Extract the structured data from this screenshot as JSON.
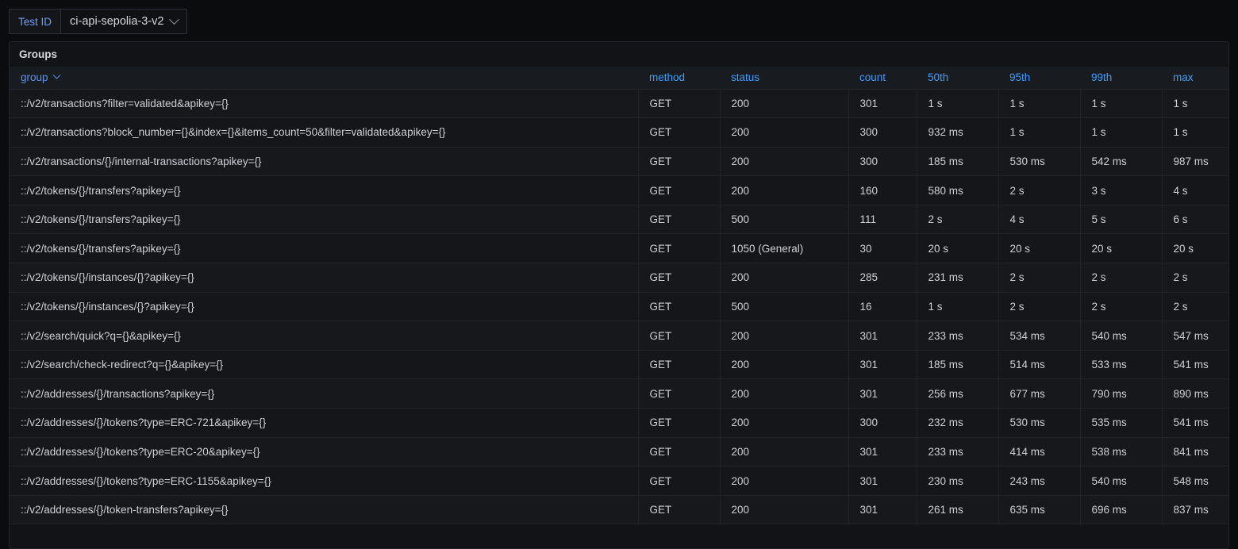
{
  "variables": {
    "test_id": {
      "label": "Test ID",
      "value": "ci-api-sepolia-3-v2",
      "chevron_icon": "chevron-down-icon"
    }
  },
  "panel": {
    "title": "Groups",
    "table": {
      "columns": [
        {
          "key": "group",
          "label": "group",
          "sorted": true,
          "sort_icon": "chevron-down-icon"
        },
        {
          "key": "method",
          "label": "method",
          "sorted": false
        },
        {
          "key": "status",
          "label": "status",
          "sorted": false
        },
        {
          "key": "count",
          "label": "count",
          "sorted": false
        },
        {
          "key": "p50",
          "label": "50th",
          "sorted": false
        },
        {
          "key": "p95",
          "label": "95th",
          "sorted": false
        },
        {
          "key": "p99",
          "label": "99th",
          "sorted": false
        },
        {
          "key": "max",
          "label": "max",
          "sorted": false
        }
      ],
      "rows": [
        {
          "group": "::/v2/transactions?filter=validated&apikey={}",
          "method": "GET",
          "status": "200",
          "count": "301",
          "p50": "1 s",
          "p95": "1 s",
          "p99": "1 s",
          "max": "1 s"
        },
        {
          "group": "::/v2/transactions?block_number={}&index={}&items_count=50&filter=validated&apikey={}",
          "method": "GET",
          "status": "200",
          "count": "300",
          "p50": "932 ms",
          "p95": "1 s",
          "p99": "1 s",
          "max": "1 s"
        },
        {
          "group": "::/v2/transactions/{}/internal-transactions?apikey={}",
          "method": "GET",
          "status": "200",
          "count": "300",
          "p50": "185 ms",
          "p95": "530 ms",
          "p99": "542 ms",
          "max": "987 ms"
        },
        {
          "group": "::/v2/tokens/{}/transfers?apikey={}",
          "method": "GET",
          "status": "200",
          "count": "160",
          "p50": "580 ms",
          "p95": "2 s",
          "p99": "3 s",
          "max": "4 s"
        },
        {
          "group": "::/v2/tokens/{}/transfers?apikey={}",
          "method": "GET",
          "status": "500",
          "count": "111",
          "p50": "2 s",
          "p95": "4 s",
          "p99": "5 s",
          "max": "6 s"
        },
        {
          "group": "::/v2/tokens/{}/transfers?apikey={}",
          "method": "GET",
          "status": "1050 (General)",
          "count": "30",
          "p50": "20 s",
          "p95": "20 s",
          "p99": "20 s",
          "max": "20 s"
        },
        {
          "group": "::/v2/tokens/{}/instances/{}?apikey={}",
          "method": "GET",
          "status": "200",
          "count": "285",
          "p50": "231 ms",
          "p95": "2 s",
          "p99": "2 s",
          "max": "2 s"
        },
        {
          "group": "::/v2/tokens/{}/instances/{}?apikey={}",
          "method": "GET",
          "status": "500",
          "count": "16",
          "p50": "1 s",
          "p95": "2 s",
          "p99": "2 s",
          "max": "2 s"
        },
        {
          "group": "::/v2/search/quick?q={}&apikey={}",
          "method": "GET",
          "status": "200",
          "count": "301",
          "p50": "233 ms",
          "p95": "534 ms",
          "p99": "540 ms",
          "max": "547 ms"
        },
        {
          "group": "::/v2/search/check-redirect?q={}&apikey={}",
          "method": "GET",
          "status": "200",
          "count": "301",
          "p50": "185 ms",
          "p95": "514 ms",
          "p99": "533 ms",
          "max": "541 ms"
        },
        {
          "group": "::/v2/addresses/{}/transactions?apikey={}",
          "method": "GET",
          "status": "200",
          "count": "301",
          "p50": "256 ms",
          "p95": "677 ms",
          "p99": "790 ms",
          "max": "890 ms"
        },
        {
          "group": "::/v2/addresses/{}/tokens?type=ERC-721&apikey={}",
          "method": "GET",
          "status": "200",
          "count": "300",
          "p50": "232 ms",
          "p95": "530 ms",
          "p99": "535 ms",
          "max": "541 ms"
        },
        {
          "group": "::/v2/addresses/{}/tokens?type=ERC-20&apikey={}",
          "method": "GET",
          "status": "200",
          "count": "301",
          "p50": "233 ms",
          "p95": "414 ms",
          "p99": "538 ms",
          "max": "841 ms"
        },
        {
          "group": "::/v2/addresses/{}/tokens?type=ERC-1155&apikey={}",
          "method": "GET",
          "status": "200",
          "count": "301",
          "p50": "230 ms",
          "p95": "243 ms",
          "p99": "540 ms",
          "max": "548 ms"
        },
        {
          "group": "::/v2/addresses/{}/token-transfers?apikey={}",
          "method": "GET",
          "status": "200",
          "count": "301",
          "p50": "261 ms",
          "p95": "635 ms",
          "p99": "696 ms",
          "max": "837 ms"
        }
      ]
    }
  },
  "colors": {
    "page_background": "#0b0c0e",
    "panel_background": "#111317",
    "header_text": "#3c9dfd",
    "variable_label": "#6e9fff",
    "cell_text": "#cdd0d6"
  }
}
